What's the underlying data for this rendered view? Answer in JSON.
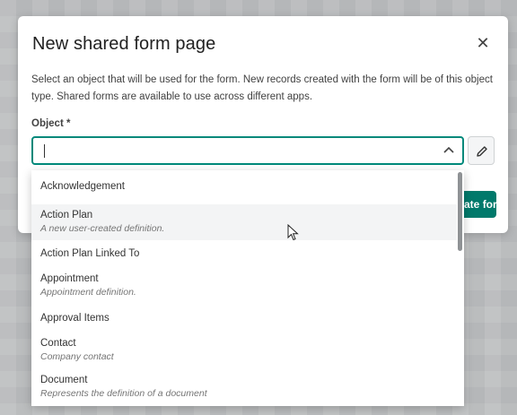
{
  "modal": {
    "title": "New shared form page",
    "description": "Select an object that will be used for the form. New records created with the form will be of this object type. Shared forms are available to use across different apps.",
    "field_label": "Object *",
    "input_value": "",
    "create_button_label": "Create form",
    "close_icon": "close-icon",
    "edit_icon": "pencil-icon",
    "accent_color": "#00796b"
  },
  "dropdown": {
    "options": [
      {
        "label": "Acknowledgement",
        "desc": ""
      },
      {
        "label": "Action Plan",
        "desc": "A new user-created definition."
      },
      {
        "label": "Action Plan Linked To",
        "desc": ""
      },
      {
        "label": "Appointment",
        "desc": "Appointment definition."
      },
      {
        "label": "Approval Items",
        "desc": ""
      },
      {
        "label": "Contact",
        "desc": "Company contact"
      },
      {
        "label": "Document",
        "desc": "Represents the definition of a document"
      }
    ]
  }
}
